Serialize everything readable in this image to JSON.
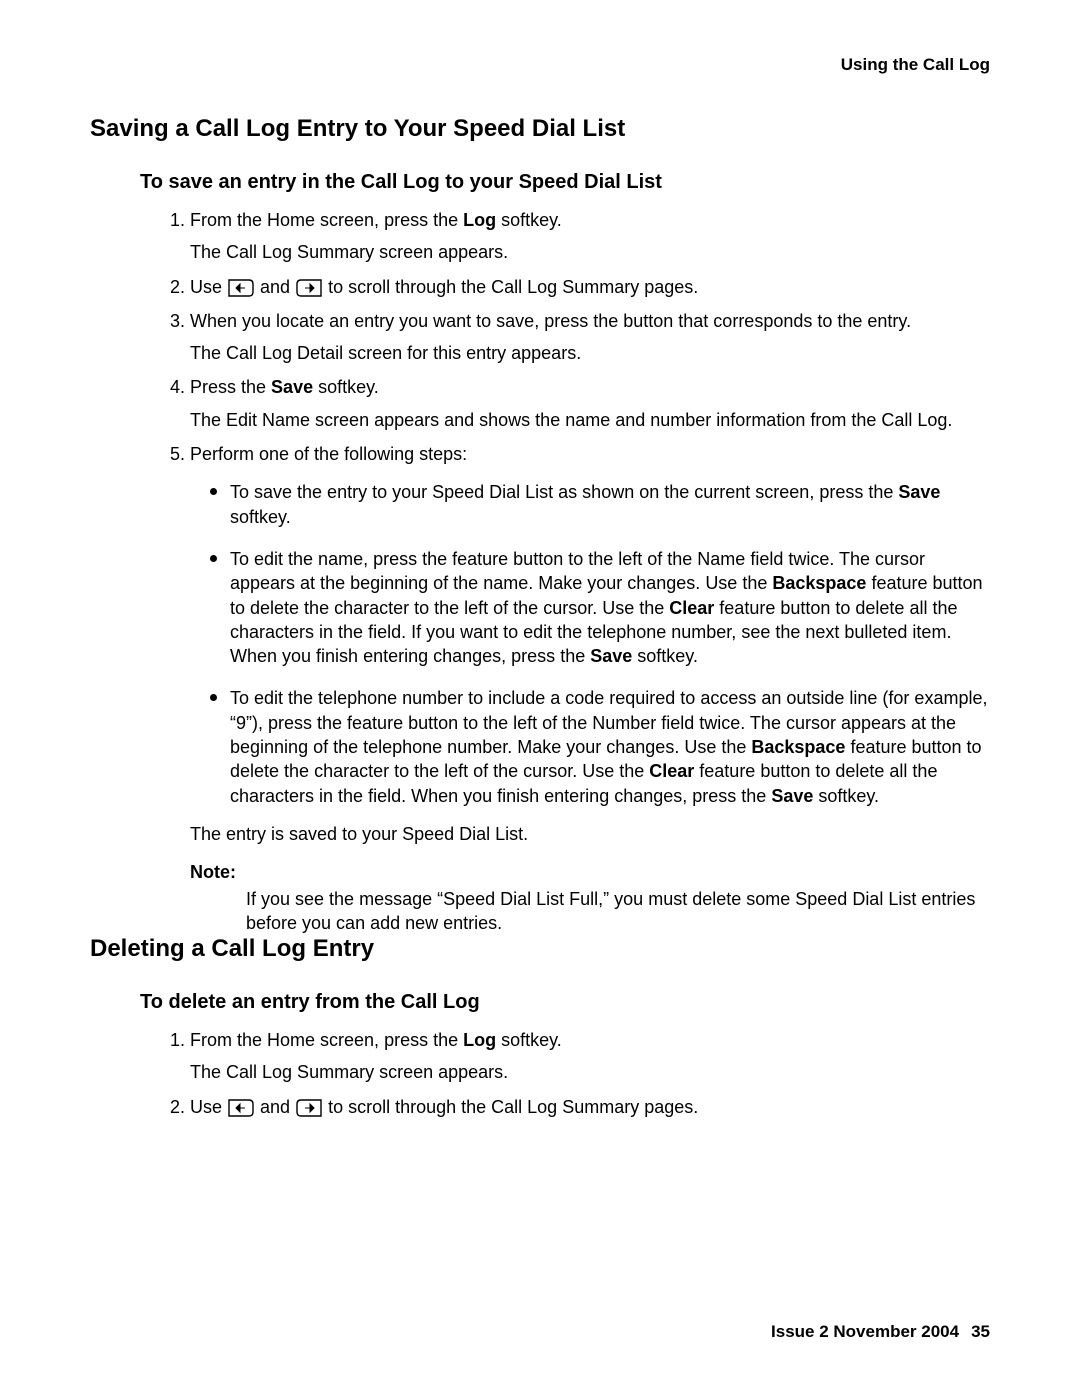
{
  "header": {
    "breadcrumb": "Using the Call Log"
  },
  "section1": {
    "title": "Saving a Call Log Entry to Your Speed Dial List",
    "subtitle": "To save an entry in the Call Log to your Speed Dial List",
    "steps": {
      "s1a": "From the Home screen, press the ",
      "s1b": "Log",
      "s1c": " softkey.",
      "s1r": "The Call Log Summary screen appears.",
      "s2a": "Use ",
      "s2b": " and ",
      "s2c": " to scroll through the Call Log Summary pages.",
      "s3a": "When you locate an entry you want to save, press the button that corresponds to the entry.",
      "s3r": "The Call Log Detail screen for this entry appears.",
      "s4a": "Press the ",
      "s4b": "Save",
      "s4c": " softkey.",
      "s4r": "The Edit Name screen appears and shows the name and number information from the Call Log.",
      "s5a": "Perform one of the following steps:",
      "b1a": "To save the entry to your Speed Dial List as shown on the current screen, press the ",
      "b1b": "Save",
      "b1c": " softkey.",
      "b2a": "To edit the name, press the feature button to the left of the Name field twice. The cursor appears at the beginning of the name. Make your changes. Use the ",
      "b2b": "Backspace",
      "b2c": " feature button to delete the character to the left of the cursor. Use the ",
      "b2d": "Clear",
      "b2e": " feature button to delete all the characters in the field. If you want to edit the telephone number, see the next bulleted item. When you finish entering changes, press the ",
      "b2f": "Save",
      "b2g": " softkey.",
      "b3a": "To edit the telephone number to include a code required to access an outside line (for example, “9”), press the feature button to the left of the Number field twice. The cursor appears at the beginning of the telephone number. Make your changes. Use the ",
      "b3b": "Backspace",
      "b3c": " feature button to delete the character to the left of the cursor. Use the ",
      "b3d": "Clear",
      "b3e": " feature button to delete all the characters in the field. When you finish entering changes, press the ",
      "b3f": "Save",
      "b3g": " softkey.",
      "s5r": "The entry is saved to your Speed Dial List."
    },
    "note": {
      "label": "Note:",
      "body": "If you see the message “Speed Dial List Full,” you must delete some Speed Dial List entries before you can add new entries."
    }
  },
  "section2": {
    "title": "Deleting a Call Log Entry",
    "subtitle": "To delete an entry from the Call Log",
    "steps": {
      "s1a": "From the Home screen, press the ",
      "s1b": "Log",
      "s1c": " softkey.",
      "s1r": "The Call Log Summary screen appears.",
      "s2a": "Use ",
      "s2b": " and ",
      "s2c": " to scroll through the Call Log Summary pages."
    }
  },
  "footer": {
    "issue": "Issue 2   November 2004",
    "page": "35"
  }
}
